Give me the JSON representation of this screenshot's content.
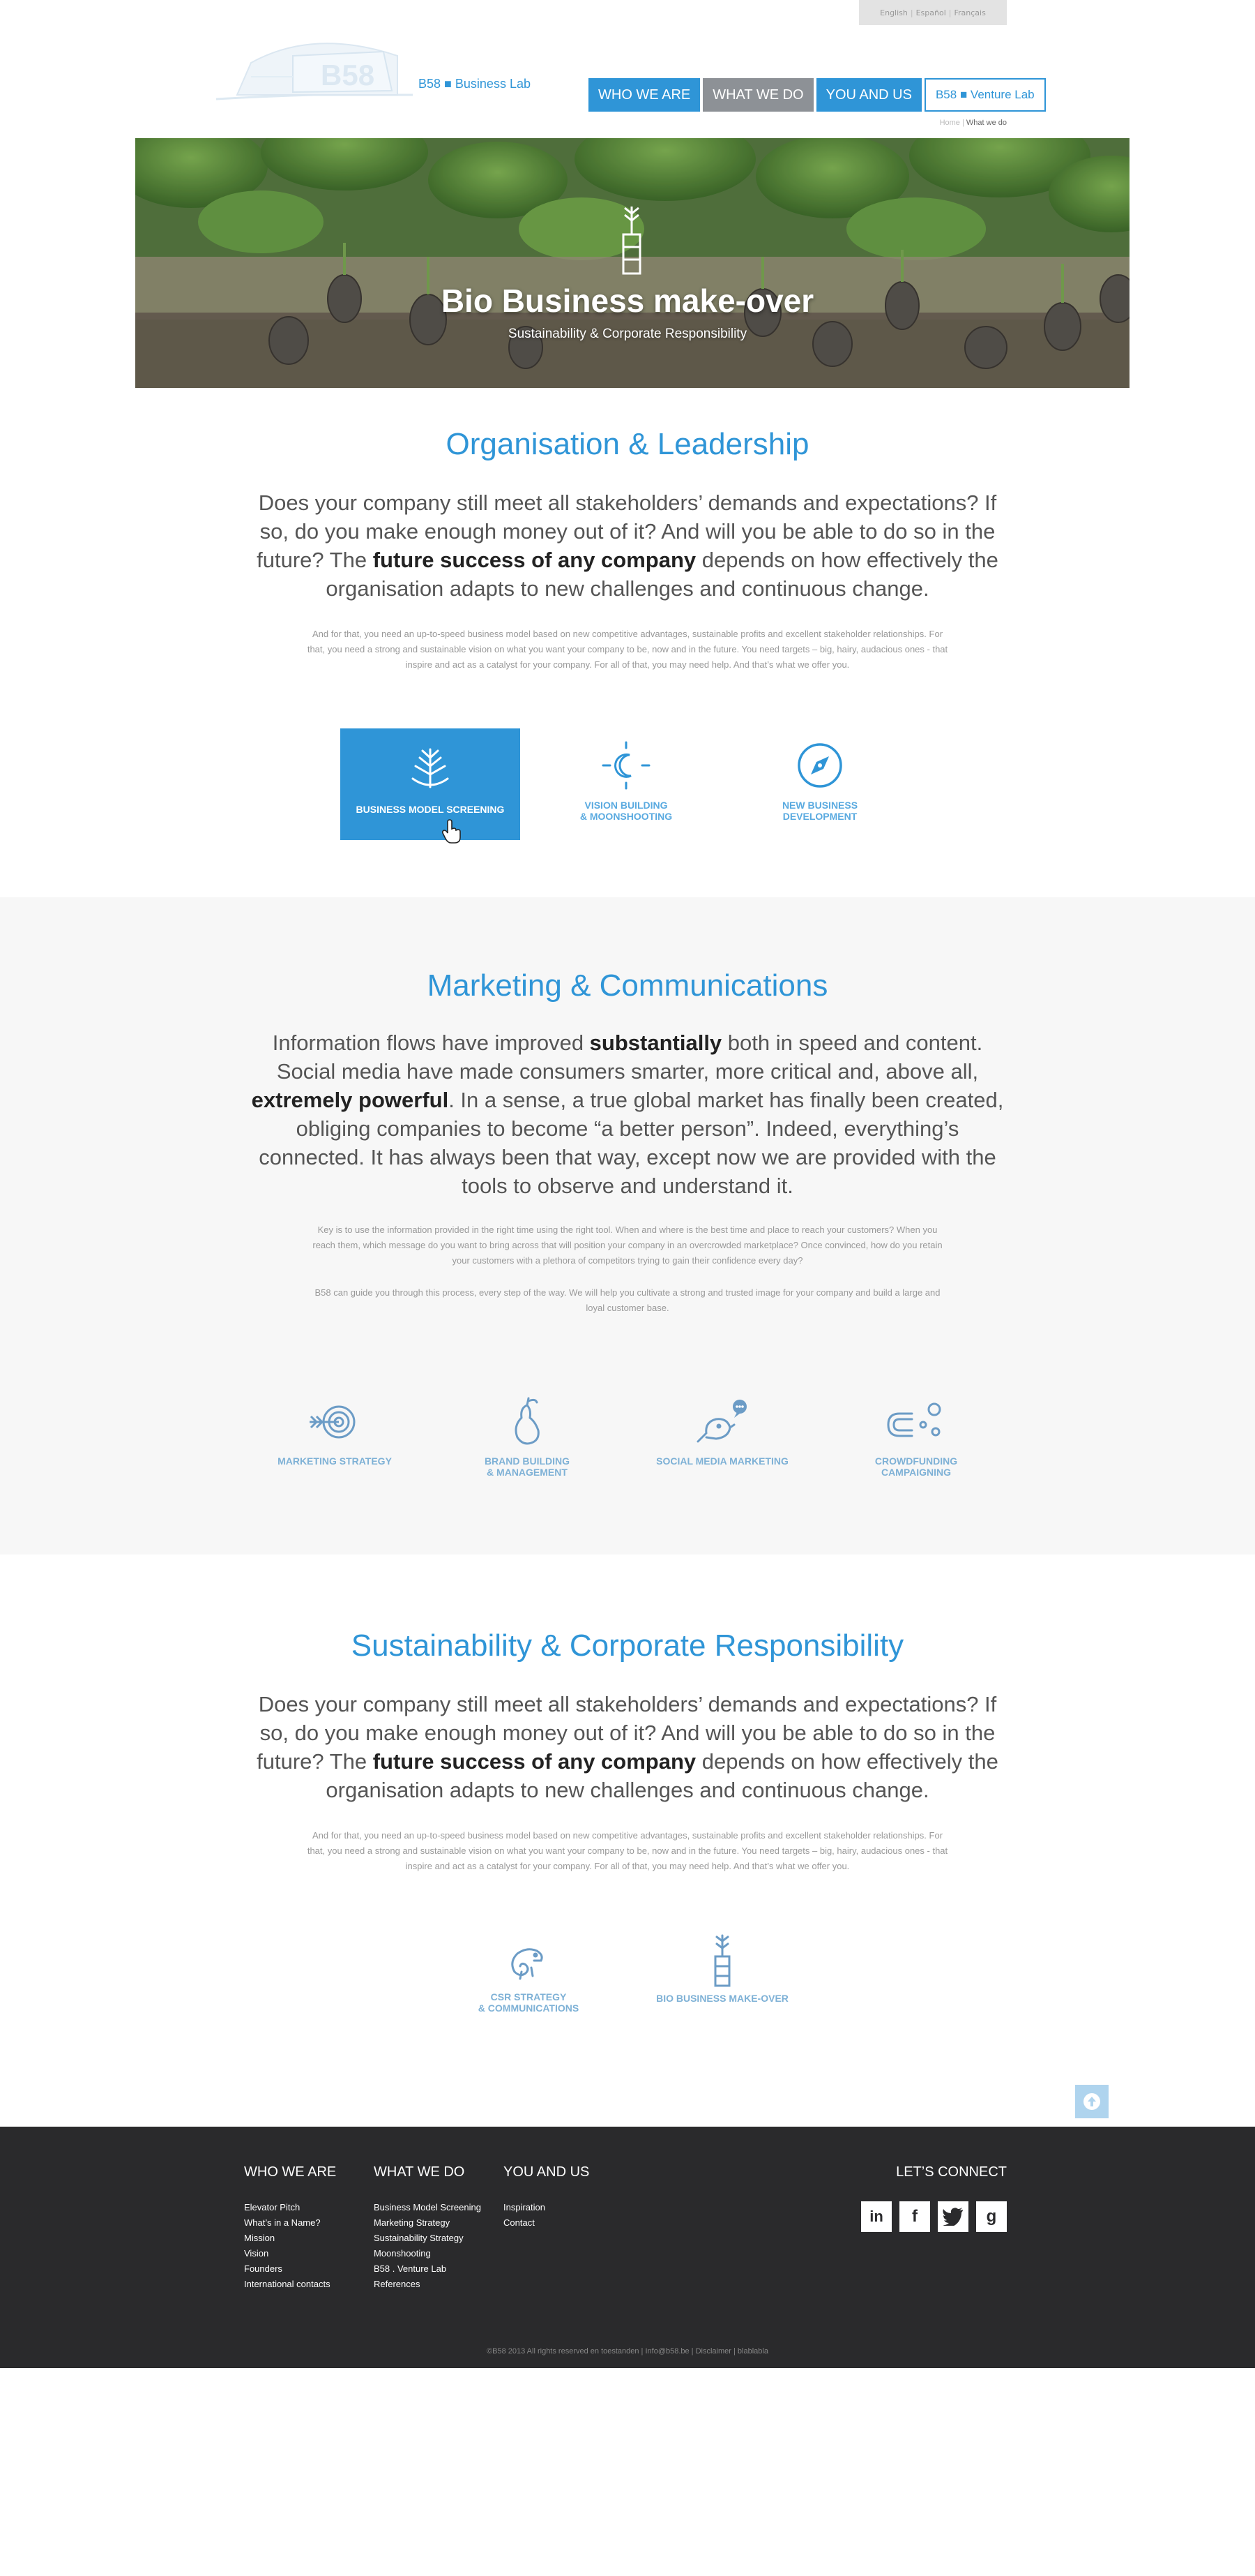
{
  "language_bar": {
    "english": "English",
    "espanol": "Español",
    "francais": "Français",
    "sep": "|"
  },
  "header": {
    "logo_text": "B58 ■ Business Lab",
    "nav": [
      "WHO WE ARE",
      "WHAT WE DO",
      "YOU AND US",
      "B58 ■ Venture Lab"
    ],
    "breadcrumb": {
      "home": "Home",
      "sep": "|",
      "current": "What we do"
    }
  },
  "hero": {
    "title": "Bio Business make-over",
    "subtitle": "Sustainability & Corporate Responsibility"
  },
  "section1": {
    "title": "Organisation & Leadership",
    "lead_a": "Does your company still meet all stakeholders’ demands and expectations? If so, do you make enough money out of it? And will you be able to do so in the future? The ",
    "lead_bold": "future success of any company",
    "lead_b": " depends on how effectively the organisation adapts to new challenges and continuous change.",
    "body": "And for that, you need an up-to-speed business model based on new competitive advantages, sustainable profits and excellent stakeholder relationships. For that, you need a strong and sustainable vision on what you want your company to be, now and in the future. You need targets – big, hairy, audacious ones - that inspire and act as a catalyst for your company.  For all of that, you may need help. And that’s what we offer you.",
    "tiles": [
      {
        "label": "BUSINESS MODEL SCREENING",
        "icon": "tree-icon"
      },
      {
        "label": "VISION BUILDING\n& MOONSHOOTING",
        "icon": "moon-icon"
      },
      {
        "label": "NEW BUSINESS\nDEVELOPMENT",
        "icon": "compass-icon"
      }
    ]
  },
  "section2": {
    "title": "Marketing & Communications",
    "lead_a": "Information flows have improved ",
    "lead_bold1": "substantially",
    "lead_b": " both in speed and content. Social media have made consumers smarter, more critical and, above all, ",
    "lead_bold2": "extremely powerful",
    "lead_c": ". In a sense, a true global market has finally been created, obliging companies to become “a better person”. Indeed, everything’s connected. It has always been that way, except now we are provided with the tools to observe and understand it.",
    "body1": "Key is to use the information provided in the right time using the right tool. When and where is the best time and place to reach your customers? When you reach them, which message do you want to bring across that will position your company in an overcrowded marketplace? Once convinced, how do you retain your customers with a plethora of competitors trying to gain their confidence every day?",
    "body2": "B58 can guide you through this process, every step of the way. We will help you cultivate a strong and trusted image for your company and build a large and loyal customer base.",
    "tiles": [
      {
        "label": "MARKETING STRATEGY",
        "icon": "target-icon"
      },
      {
        "label": "BRAND BUILDING\n& MANAGEMENT",
        "icon": "pear-icon"
      },
      {
        "label": "SOCIAL MEDIA MARKETING",
        "icon": "bird-icon"
      },
      {
        "label": "CROWDFUNDING\nCAMPAIGNING",
        "icon": "magnet-icon"
      }
    ]
  },
  "section3": {
    "title": "Sustainability & Corporate Responsibility",
    "lead_a": "Does your company still meet all stakeholders’ demands and expectations? If so, do you make enough money out of it? And will you be able to do so in the future? The ",
    "lead_bold": "future success of any company",
    "lead_b": " depends on how effectively the organisation adapts to new challenges and continuous change.",
    "body": "And for that, you need an up-to-speed business model based on new competitive advantages, sustainable profits and excellent stakeholder relationships. For that, you need a strong and sustainable vision on what you want your company to be, now and in the future. You need targets – big, hairy, audacious ones - that inspire and act as a catalyst for your company.  For all of that, you may need help. And that’s what we offer you.",
    "tiles": [
      {
        "label": "CSR STRATEGY\n& COMMUNICATIONS",
        "icon": "chameleon-icon"
      },
      {
        "label": "BIO BUSINESS MAKE-OVER",
        "icon": "sprout-icon"
      }
    ]
  },
  "footer": {
    "who": {
      "title": "WHO WE ARE",
      "items": [
        "Elevator Pitch",
        "What’s in a Name?",
        "Mission",
        "Vision",
        "Founders",
        "International contacts"
      ]
    },
    "what": {
      "title": "WHAT WE DO",
      "items": [
        "Business Model Screening",
        "Marketing Strategy",
        "Sustainability Strategy",
        "Moonshooting",
        "B58 . Venture Lab",
        "References"
      ]
    },
    "you": {
      "title": "YOU AND US",
      "items": [
        "Inspiration",
        "Contact"
      ]
    },
    "connect": {
      "title": "LET’S CONNECT",
      "socials": [
        "in",
        "f",
        "twitter",
        "g"
      ]
    },
    "copyright": "©B58 2013 All rights reserved en toestanden | Info@b58.be | Disclaimer | blablabla"
  },
  "colors": {
    "accent": "#2f95d7",
    "footer_bg": "#2a2a2c",
    "band_bg": "#f7f7f7"
  }
}
